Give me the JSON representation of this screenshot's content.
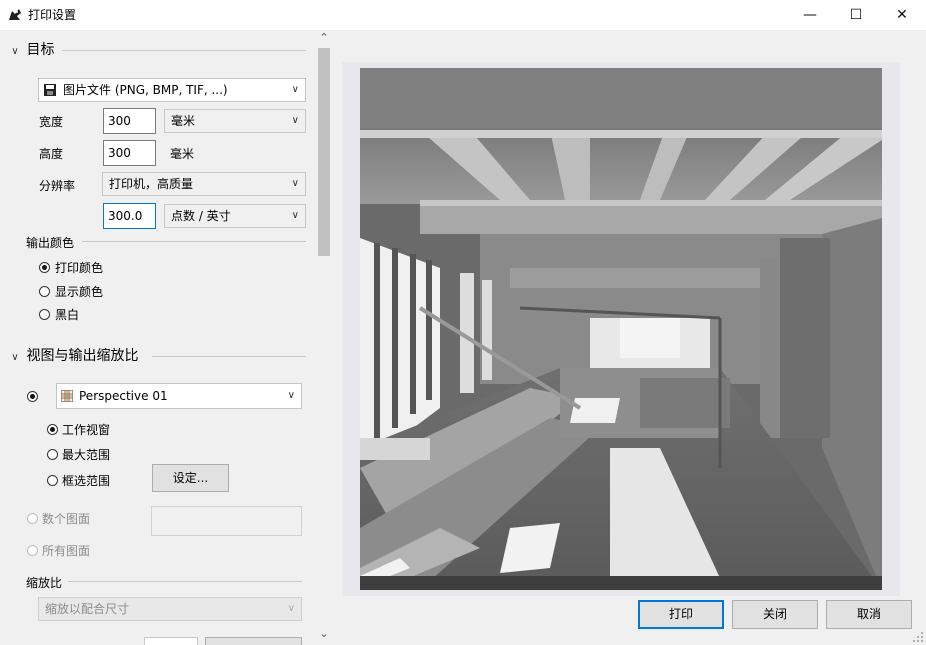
{
  "window": {
    "title": "打印设置",
    "controls": {
      "minimize": "—",
      "maximize": "☐",
      "close": "✕"
    }
  },
  "target": {
    "header": "目标",
    "destination": "图片文件 (PNG, BMP, TIF, ...)",
    "width_label": "宽度",
    "width_value": "300",
    "width_unit": "毫米",
    "height_label": "高度",
    "height_value": "300",
    "height_unit": "毫米",
    "resolution_label": "分辨率",
    "resolution_preset": "打印机，高质量",
    "resolution_value": "300.0",
    "resolution_unit": "点数 / 英寸"
  },
  "output_color": {
    "header": "输出颜色",
    "options": [
      "打印颜色",
      "显示颜色",
      "黑白"
    ],
    "selected": 0
  },
  "view_scale": {
    "header": "视图与输出缩放比",
    "viewport": "Perspective 01",
    "area_options": [
      "工作视窗",
      "最大范围",
      "框选范围"
    ],
    "area_selected": 0,
    "set_button": "设定...",
    "multi_pages": "数个图面",
    "all_pages": "所有图面"
  },
  "scale": {
    "header": "缩放比",
    "value": "缩放以配合尺寸"
  },
  "buttons": {
    "print": "打印",
    "close": "关闭",
    "cancel": "取消"
  },
  "scroll": {
    "up": "⌃",
    "down": "⌄"
  },
  "colors": {
    "accent": "#0078d7"
  }
}
